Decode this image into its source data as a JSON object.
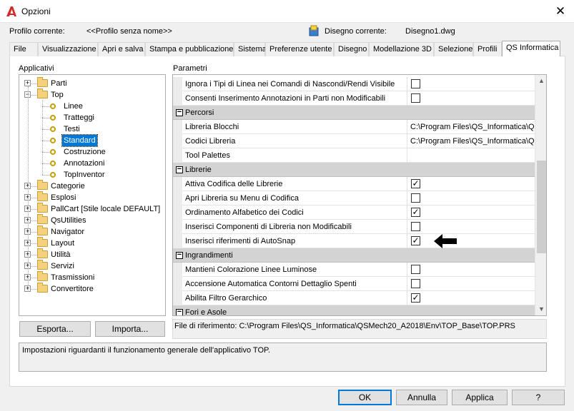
{
  "window": {
    "title": "Opzioni",
    "close_glyph": "✕"
  },
  "header": {
    "profile_label": "Profilo corrente:",
    "profile_value": "<<Profilo senza nome>>",
    "drawing_label": "Disegno corrente:",
    "drawing_value": "Disegno1.dwg"
  },
  "tabs": [
    "File",
    "Visualizzazione",
    "Apri e salva",
    "Stampa e pubblicazione",
    "Sistema",
    "Preferenze utente",
    "Disegno",
    "Modellazione 3D",
    "Selezione",
    "Profili",
    "QS Informatica"
  ],
  "left": {
    "group_label": "Applicativi",
    "tree": [
      {
        "label": "Parti",
        "type": "folder",
        "expander": "+"
      },
      {
        "label": "Top",
        "type": "folder",
        "expander": "−"
      },
      {
        "label": "Linee",
        "type": "leaf"
      },
      {
        "label": "Tratteggi",
        "type": "leaf"
      },
      {
        "label": "Testi",
        "type": "leaf"
      },
      {
        "label": "Standard",
        "type": "leaf",
        "selected": true
      },
      {
        "label": "Costruzione",
        "type": "leaf"
      },
      {
        "label": "Annotazioni",
        "type": "leaf"
      },
      {
        "label": "TopInventor",
        "type": "leaf"
      },
      {
        "label": "Categorie",
        "type": "folder",
        "expander": "+"
      },
      {
        "label": "Esplosi",
        "type": "folder",
        "expander": "+"
      },
      {
        "label": "PallCart [Stile locale DEFAULT]",
        "type": "folder",
        "expander": "+"
      },
      {
        "label": "QsUtilities",
        "type": "folder",
        "expander": "+"
      },
      {
        "label": "Navigator",
        "type": "folder",
        "expander": "+"
      },
      {
        "label": "Layout",
        "type": "folder",
        "expander": "+"
      },
      {
        "label": "Utilità",
        "type": "folder",
        "expander": "+"
      },
      {
        "label": "Servizi",
        "type": "folder",
        "expander": "+"
      },
      {
        "label": "Trasmissioni",
        "type": "folder",
        "expander": "+"
      },
      {
        "label": "Convertitore",
        "type": "folder",
        "expander": "+"
      }
    ],
    "export_label": "Esporta...",
    "import_label": "Importa..."
  },
  "right": {
    "group_label": "Parametri",
    "rows": [
      {
        "kind": "prop",
        "name": "Ignora i Tipi di Linea nei Comandi di Nascondi/Rendi Visibile",
        "check": false
      },
      {
        "kind": "prop",
        "name": "Consenti Inserimento Annotazioni in Parti non Modificabili",
        "check": false
      },
      {
        "kind": "cat",
        "name": "Percorsi",
        "box": "−"
      },
      {
        "kind": "prop",
        "name": "Libreria Blocchi",
        "text": "C:\\Program Files\\QS_Informatica\\QS"
      },
      {
        "kind": "prop",
        "name": "Codici Libreria",
        "text": "C:\\Program Files\\QS_Informatica\\QS"
      },
      {
        "kind": "prop",
        "name": "Tool Palettes",
        "text": ""
      },
      {
        "kind": "cat",
        "name": "Librerie",
        "box": "−"
      },
      {
        "kind": "prop",
        "name": "Attiva Codifica delle Librerie",
        "check": true
      },
      {
        "kind": "prop",
        "name": "Apri Libreria su Menu di Codifica",
        "check": false
      },
      {
        "kind": "prop",
        "name": "Ordinamento Alfabetico dei Codici",
        "check": true
      },
      {
        "kind": "prop",
        "name": "Inserisci Componenti di Libreria non Modificabili",
        "check": false
      },
      {
        "kind": "prop",
        "name": "Inserisci riferimenti di AutoSnap",
        "check": true,
        "arrow": true
      },
      {
        "kind": "cat",
        "name": "Ingrandimenti",
        "box": "−"
      },
      {
        "kind": "prop",
        "name": "Mantieni Colorazione Linee Luminose",
        "check": false
      },
      {
        "kind": "prop",
        "name": "Accensione Automatica Contorni Dettaglio Spenti",
        "check": false
      },
      {
        "kind": "prop",
        "name": "Abilita Filtro Gerarchico",
        "check": true
      },
      {
        "kind": "cat",
        "name": "Fori e Asole",
        "box": "−"
      }
    ],
    "ref_file": "File di riferimento: C:\\Program Files\\QS_Informatica\\QSMech20_A2018\\Env\\TOP_Base\\TOP.PRS"
  },
  "description": "Impostazioni riguardanti il funzionamento generale dell'applicativo TOP.",
  "footer": {
    "ok": "OK",
    "cancel": "Annulla",
    "apply": "Applica",
    "help": "?"
  },
  "glyphs": {
    "check": "✓",
    "scroll_up": "▲",
    "scroll_down": "▼"
  },
  "colors": {
    "accent": "#0078d7",
    "category_bg": "#d3d3d3",
    "app_icon": "#d42a2a"
  }
}
